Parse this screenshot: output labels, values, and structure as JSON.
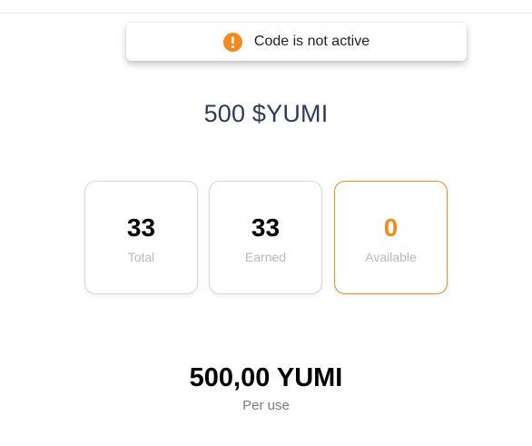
{
  "toast": {
    "icon": "exclamation-circle-icon",
    "message": "Code is not active",
    "icon_color": "#f5891f"
  },
  "balance": {
    "title": "500 $YUMI"
  },
  "stats": {
    "total": {
      "value": "33",
      "label": "Total"
    },
    "earned": {
      "value": "33",
      "label": "Earned"
    },
    "available": {
      "value": "0",
      "label": "Available",
      "accent_color": "#f5891f"
    }
  },
  "price": {
    "amount": "500,00 YUMI",
    "caption": "Per use"
  }
}
